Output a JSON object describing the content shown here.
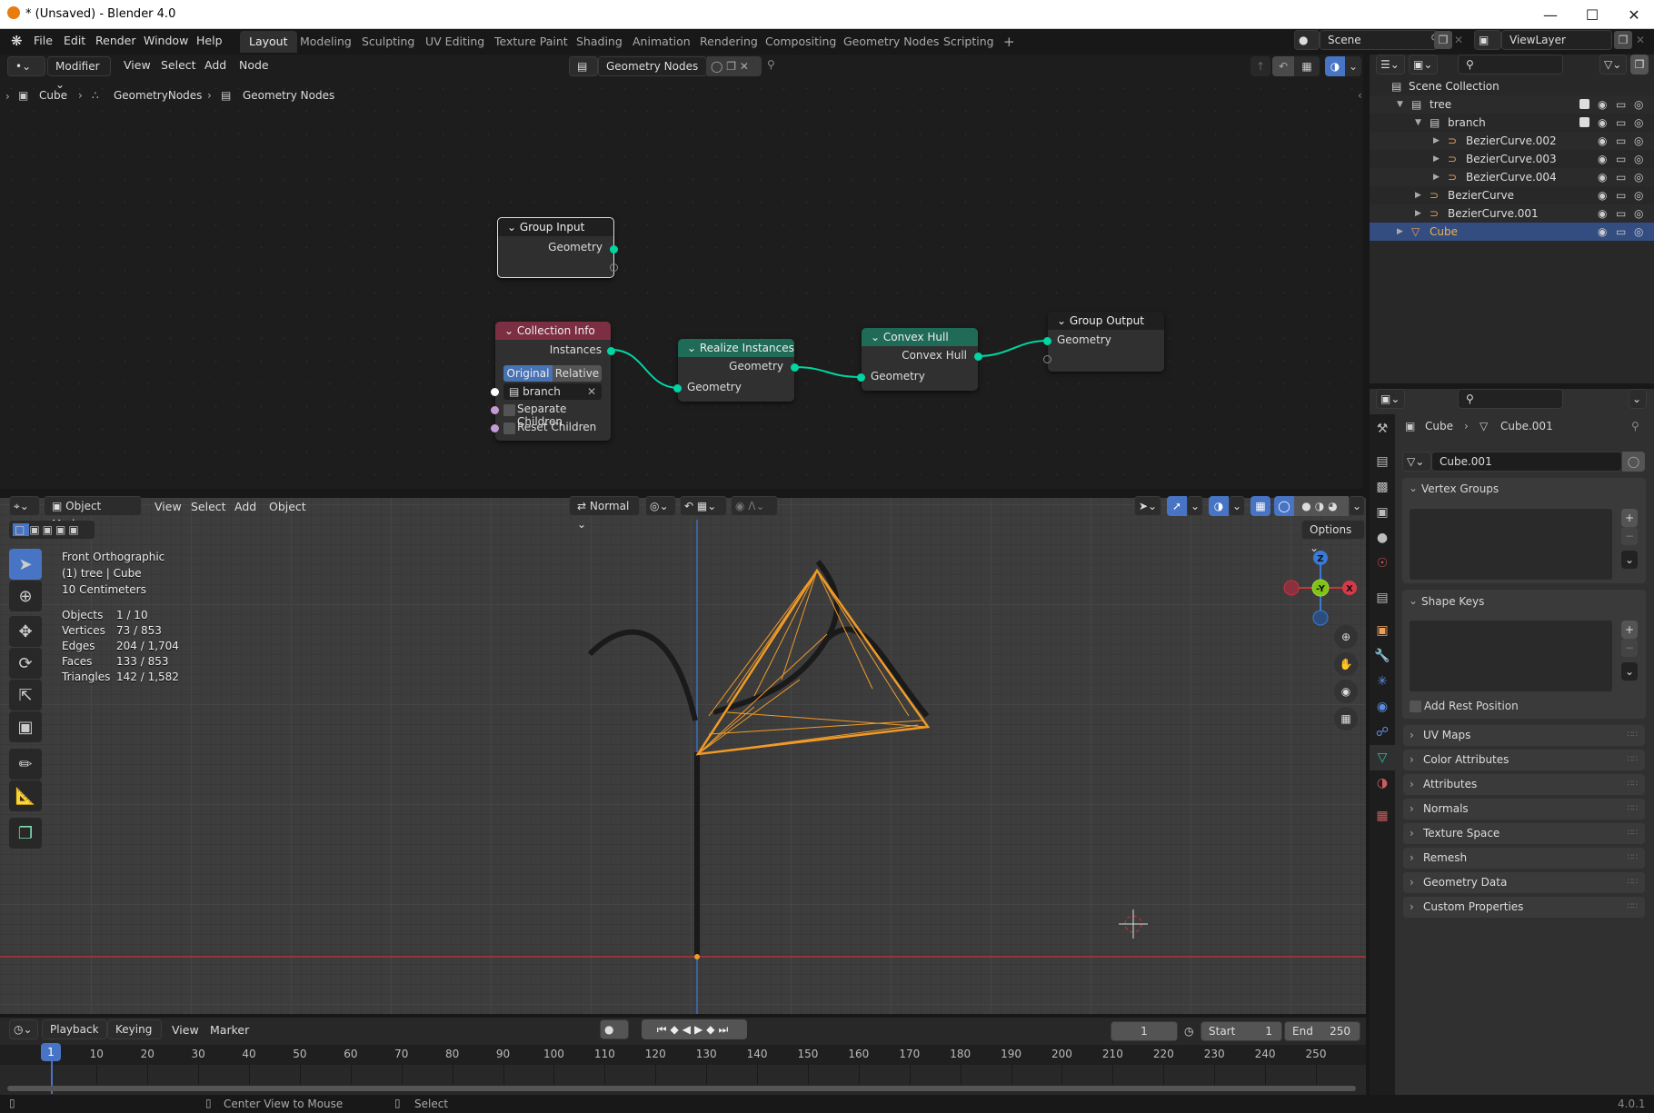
{
  "window": {
    "title": "* (Unsaved) - Blender 4.0",
    "controls": [
      "minimize",
      "maximize",
      "close"
    ]
  },
  "menu": [
    "File",
    "Edit",
    "Render",
    "Window",
    "Help"
  ],
  "workspaces": [
    {
      "label": "Layout",
      "active": true
    },
    {
      "label": "Modeling"
    },
    {
      "label": "Sculpting"
    },
    {
      "label": "UV Editing"
    },
    {
      "label": "Texture Paint"
    },
    {
      "label": "Shading"
    },
    {
      "label": "Animation"
    },
    {
      "label": "Rendering"
    },
    {
      "label": "Compositing"
    },
    {
      "label": "Geometry Nodes"
    },
    {
      "label": "Scripting"
    }
  ],
  "add_workspace": "+",
  "scene": {
    "label": "Scene",
    "view_layer": "ViewLayer"
  },
  "node_editor": {
    "mode": "Modifier",
    "menus": [
      "View",
      "Select",
      "Add",
      "Node"
    ],
    "node_tree": "Geometry Nodes",
    "breadcrumb": [
      "Cube",
      "GeometryNodes",
      "Geometry Nodes"
    ],
    "nodes": {
      "group_input": {
        "title": "Group Input",
        "output": "Geometry"
      },
      "collection_info": {
        "title": "Collection Info",
        "output": "Instances",
        "transform_options": [
          "Original",
          "Relative"
        ],
        "transform_selected": "Original",
        "collection": "branch",
        "separate_children": "Separate Children",
        "reset_children": "Reset Children"
      },
      "realize_instances": {
        "title": "Realize Instances",
        "output": "Geometry",
        "input": "Geometry"
      },
      "convex_hull": {
        "title": "Convex Hull",
        "output": "Convex Hull",
        "input": "Geometry"
      },
      "group_output": {
        "title": "Group Output",
        "input": "Geometry"
      }
    },
    "colors": {
      "socket_geometry": "#00d6a3",
      "collection_header": "#7c2e43",
      "geometry_header": "#1f6b58",
      "link": "#00d6a3"
    }
  },
  "viewport": {
    "mode": "Object Mode",
    "menus": [
      "View",
      "Select",
      "Add",
      "Object"
    ],
    "orientation": "Normal",
    "options": "Options",
    "overlay": {
      "view_name": "Front Orthographic",
      "context": "(1) tree | Cube",
      "scale": "10 Centimeters"
    },
    "stats": [
      {
        "label": "Objects",
        "value": "1 / 10"
      },
      {
        "label": "Vertices",
        "value": "73 / 853"
      },
      {
        "label": "Edges",
        "value": "204 / 1,704"
      },
      {
        "label": "Faces",
        "value": "133 / 853"
      },
      {
        "label": "Triangles",
        "value": "142 / 1,582"
      }
    ],
    "gizmo": {
      "z": "Z",
      "y": "-Y",
      "x": "X"
    },
    "colors": {
      "selection": "#f09a28",
      "x_axis": "#b0303c",
      "z_axis": "#3a6fbf"
    }
  },
  "outliner": {
    "root": "Scene Collection",
    "items": [
      {
        "name": "tree",
        "type": "collection",
        "depth": 1,
        "checked": true
      },
      {
        "name": "branch",
        "type": "collection",
        "depth": 2,
        "checked": true
      },
      {
        "name": "BezierCurve.002",
        "type": "curve",
        "depth": 3
      },
      {
        "name": "BezierCurve.003",
        "type": "curve",
        "depth": 3
      },
      {
        "name": "BezierCurve.004",
        "type": "curve",
        "depth": 3
      },
      {
        "name": "BezierCurve",
        "type": "curve",
        "depth": 2
      },
      {
        "name": "BezierCurve.001",
        "type": "curve",
        "depth": 2
      },
      {
        "name": "Cube",
        "type": "mesh",
        "depth": 1,
        "selected": true
      }
    ]
  },
  "properties": {
    "breadcrumb": [
      "Cube",
      "Cube.001"
    ],
    "mesh_name": "Cube.001",
    "vertex_groups": "Vertex Groups",
    "shape_keys": "Shape Keys",
    "add_rest_position": "Add Rest Position",
    "panels": [
      "UV Maps",
      "Color Attributes",
      "Attributes",
      "Normals",
      "Texture Space",
      "Remesh",
      "Geometry Data",
      "Custom Properties"
    ]
  },
  "timeline": {
    "menus": [
      "Playback",
      "Keying",
      "View",
      "Marker"
    ],
    "current_frame": "1",
    "start_label": "Start",
    "start": "1",
    "end_label": "End",
    "end": "250",
    "ticks": [
      "10",
      "20",
      "30",
      "40",
      "50",
      "60",
      "70",
      "80",
      "90",
      "100",
      "110",
      "120",
      "130",
      "140",
      "150",
      "160",
      "170",
      "180",
      "190",
      "200",
      "210",
      "220",
      "230",
      "240",
      "250"
    ],
    "playhead": "1"
  },
  "statusbar": {
    "middle_hint": "Center View to Mouse",
    "right_hint": "Select",
    "version": "4.0.1"
  }
}
